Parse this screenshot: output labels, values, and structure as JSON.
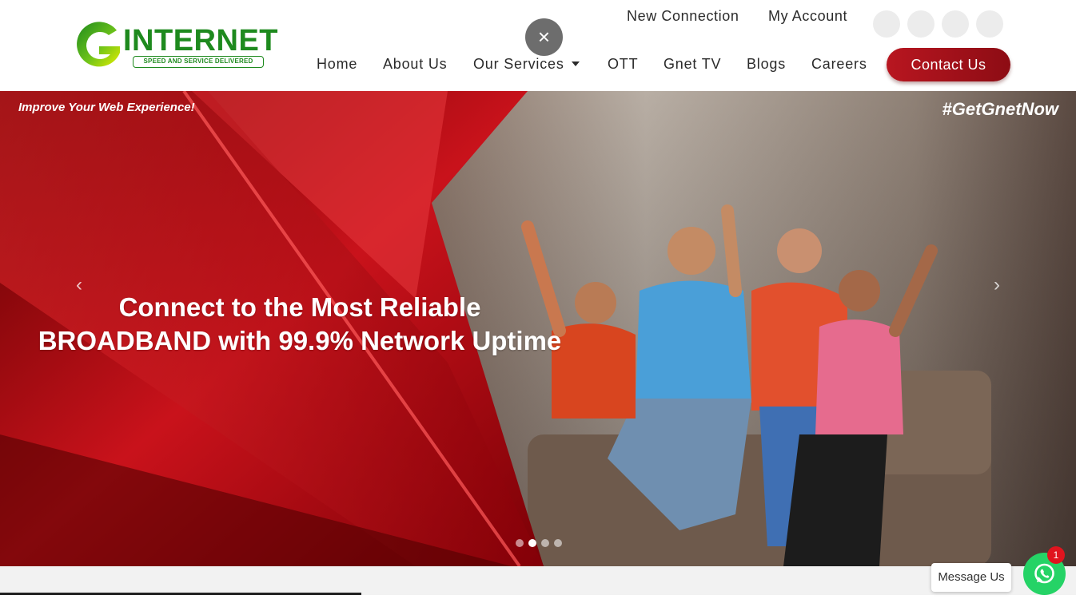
{
  "brand": {
    "wordmark": "INTERNET",
    "tagline": "SPEED AND SERVICE DELIVERED",
    "colors": {
      "green": "#1e8a1e",
      "lime": "#d8e600",
      "accent_red": "#b81620"
    }
  },
  "top_links": [
    "New Connection",
    "My Account"
  ],
  "social_icons": [
    "social-icon-1",
    "social-icon-2",
    "social-icon-3",
    "social-icon-4"
  ],
  "close_icon": "×",
  "nav": {
    "items": [
      "Home",
      "About Us",
      "Our Services",
      "OTT",
      "Gnet TV",
      "Blogs",
      "Careers"
    ],
    "contact_label": "Contact Us"
  },
  "hero": {
    "top_left": "Improve Your Web Experience!",
    "top_right": "#GetGnetNow",
    "title_line1": "Connect to the Most Reliable",
    "title_line2": "BROADBAND with 99.9% Network Uptime",
    "prev_icon": "‹",
    "next_icon": "›",
    "slides_total": 4,
    "active_slide": 2
  },
  "chat": {
    "label": "Message Us",
    "badge": "1"
  }
}
